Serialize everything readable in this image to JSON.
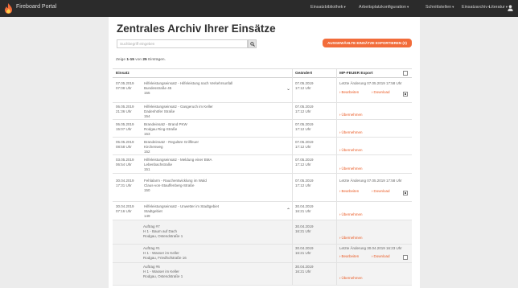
{
  "app": {
    "brand": "Fireboard Portal"
  },
  "nav": [
    {
      "label": "Einsatzbibliothek"
    },
    {
      "label": "Arbeitsplatzkonfiguration"
    },
    {
      "label": "Schnittstellen"
    },
    {
      "label": "Einsatzarchiv"
    },
    {
      "label": "Literatur"
    }
  ],
  "page": {
    "title": "Zentrales Archiv Ihrer Einsätze"
  },
  "search": {
    "placeholder": "Suchbegriff eingeben",
    "value": ""
  },
  "export_button": {
    "label": "AUSGEWÄHLTE EINSÄTZE EXPORTIEREN (2)"
  },
  "summary": {
    "prefix": "Zeige",
    "range": "1-15",
    "middle": "von",
    "total": "25",
    "suffix": "Einträgen."
  },
  "table": {
    "headers": {
      "einsatz": "Einsatz",
      "geaendert": "Geändert",
      "mp": "MP-FEUER Export"
    },
    "rows": [
      {
        "date": "07.05.2019",
        "time": "07:08 Uhr",
        "desc": "Hilfeleistungseinsatz - Hilfeleistung nach Verkehrsunfall",
        "addr": "Bundesstraße 45",
        "num": "155",
        "changed_date": "07.05.2019",
        "changed_time": "17:12 Uhr",
        "status": "Letzte Änderung 07.05.2019 17:58 Uhr",
        "edit": "Bearbeiten",
        "download": "Download",
        "takeover": "",
        "checked": true
      },
      {
        "date": "06.05.2019",
        "time": "21:36 Uhr",
        "desc": "Hilfeleistungseinsatz - Gasgeruch im Keller",
        "addr": "Dadenhöfer Straße",
        "num": "154",
        "changed_date": "07.05.2019",
        "changed_time": "17:12 Uhr",
        "status": "",
        "edit": "",
        "download": "",
        "takeover": "Übernehmen",
        "checked": false
      },
      {
        "date": "06.05.2019",
        "time": "15:07 Uhr",
        "desc": "Brandeinsatz - Brand PKW",
        "addr": "Rodgau Ring-Straße",
        "num": "153",
        "changed_date": "07.05.2019",
        "changed_time": "17:12 Uhr",
        "status": "",
        "edit": "",
        "download": "",
        "takeover": "Übernehmen",
        "checked": false
      },
      {
        "date": "05.05.2019",
        "time": "08:58 Uhr",
        "desc": "Brandeinsatz - Reguläre Grillfeuer",
        "addr": "Kirchenweg",
        "num": "152",
        "changed_date": "07.05.2019",
        "changed_time": "17:12 Uhr",
        "status": "",
        "edit": "",
        "download": "",
        "takeover": "Übernehmen",
        "checked": false
      },
      {
        "date": "03.05.2019",
        "time": "06:54 Uhr",
        "desc": "Hilfeleistungseinsatz - Meldung einer BMA",
        "addr": "Lebenbachstraße",
        "num": "151",
        "changed_date": "07.05.2019",
        "changed_time": "17:12 Uhr",
        "status": "",
        "edit": "",
        "download": "",
        "takeover": "Übernehmen",
        "checked": false
      },
      {
        "date": "30.04.2019",
        "time": "17:31 Uhr",
        "desc": "Fehlalarm - Rauchentwicklung im Wald",
        "addr": "Claus-von-Stauffenberg-Straße",
        "num": "150",
        "changed_date": "07.05.2019",
        "changed_time": "17:12 Uhr",
        "status": "Letzte Änderung 07.05.2019 17:58 Uhr",
        "edit": "Bearbeiten",
        "download": "Download",
        "takeover": "",
        "checked": true
      },
      {
        "date": "30.04.2019",
        "time": "07:16 Uhr",
        "desc": "Hilfeleistungseinsatz - Unwetter im Stadtgebiet",
        "addr": "Stadtgebiet",
        "num": "149",
        "changed_date": "30.04.2019",
        "changed_time": "16:21 Uhr",
        "status": "",
        "edit": "",
        "download": "",
        "takeover": "Übernehmen",
        "checked": false
      }
    ],
    "subrows": [
      {
        "title": "Auftrag #7",
        "type": "H 1 - Baum auf Dach",
        "addr": "Rodgau, Ostendstraße 1",
        "changed_date": "30.04.2019",
        "changed_time": "16:21 Uhr",
        "status": "",
        "edit": "",
        "download": "",
        "takeover": "Übernehmen",
        "checked": false
      },
      {
        "title": "Auftrag #1",
        "type": "H 1 - Wasser im Keller",
        "addr": "Rodgau, Friedhofstraße 16",
        "changed_date": "30.04.2019",
        "changed_time": "16:21 Uhr",
        "status": "Letzte Änderung 30.04.2019 16:23 Uhr",
        "edit": "Bearbeiten",
        "download": "Download",
        "takeover": "",
        "checked": false
      },
      {
        "title": "Auftrag #6",
        "type": "H 1 - Wasser im Keller",
        "addr": "Rodgau, Ostendstraße 1",
        "changed_date": "30.04.2019",
        "changed_time": "16:21 Uhr",
        "status": "",
        "edit": "",
        "download": "",
        "takeover": "Übernehmen",
        "checked": false
      }
    ]
  },
  "colors": {
    "accent": "#f26c3a",
    "link": "#ea5b25",
    "topbar": "#2b2b2b",
    "brand_flame": "#f26c3a"
  },
  "icons": {
    "brand": "flame-icon",
    "search": "search-icon",
    "user": "user-icon",
    "expand": "chevron-down-icon",
    "collapse": "chevron-up-icon"
  }
}
